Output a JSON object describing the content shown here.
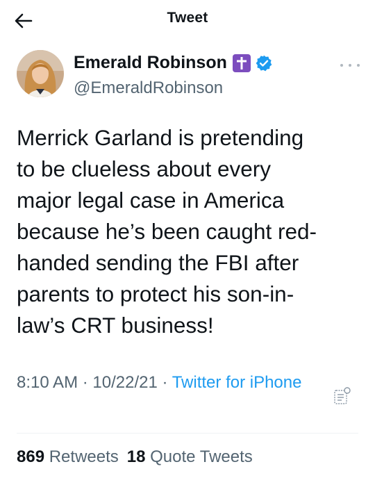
{
  "header": {
    "title": "Tweet",
    "back_icon": "arrow-left-icon"
  },
  "author": {
    "name": "Emerald Robinson",
    "handle": "@EmeraldRobinson",
    "badges": [
      "cross-icon",
      "verified-badge-icon"
    ]
  },
  "tweet": {
    "text": "Merrick Garland is pretending\nto be clueless about every\nmajor legal case in America\nbecause he’s been caught red-\nhanded sending the FBI after\nparents to protect his son-in-\nlaw’s CRT business!",
    "time": "8:10 AM",
    "date": "10/22/21",
    "separator": " · ",
    "source": "Twitter for iPhone"
  },
  "stats": {
    "retweets_count": "869",
    "retweets_label": "Retweets",
    "quotes_count": "18",
    "quotes_label": "Quote Tweets"
  },
  "colors": {
    "link": "#1d9bf0",
    "secondary_text": "#536471",
    "cross_badge": "#7c4dbe"
  }
}
